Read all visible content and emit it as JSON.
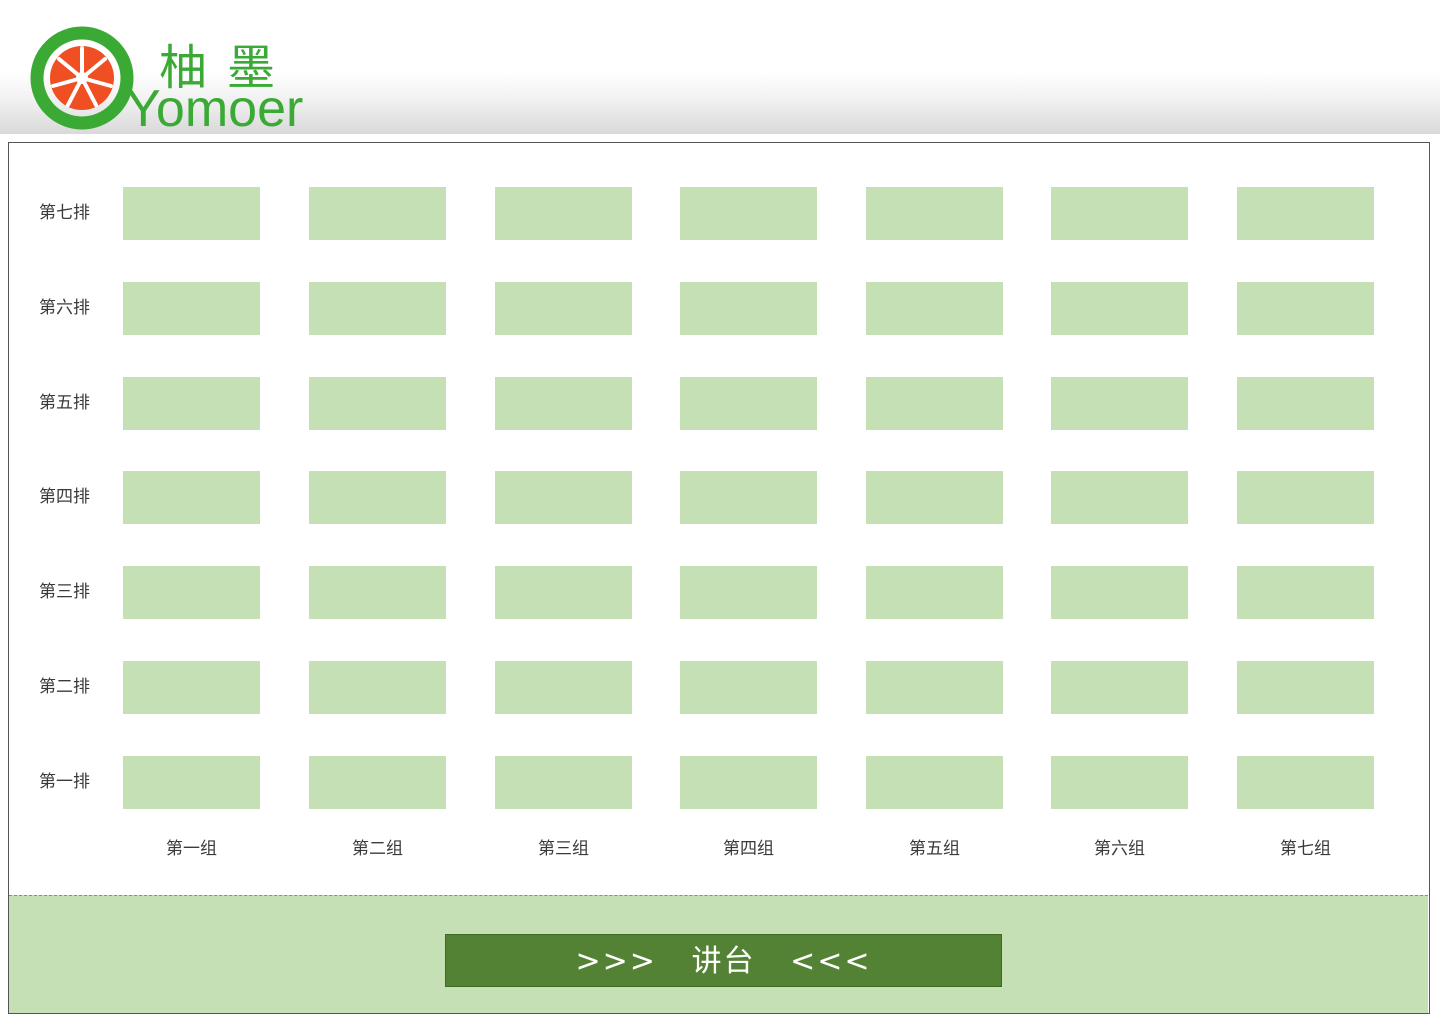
{
  "brand": {
    "name_cn": "柚墨",
    "name_en": "Yomoer",
    "colors": {
      "green": "#3aaa35",
      "orange": "#f04e23"
    }
  },
  "seating": {
    "rows": [
      "第七排",
      "第六排",
      "第五排",
      "第四排",
      "第三排",
      "第二排",
      "第一排"
    ],
    "groups": [
      "第一组",
      "第二组",
      "第三组",
      "第四组",
      "第五组",
      "第六组",
      "第七组"
    ],
    "desk_color": "#c5e0b4"
  },
  "stage": {
    "label": ">>>   讲台   <<<",
    "area_color": "#c5e0b4",
    "button_color": "#548235"
  }
}
